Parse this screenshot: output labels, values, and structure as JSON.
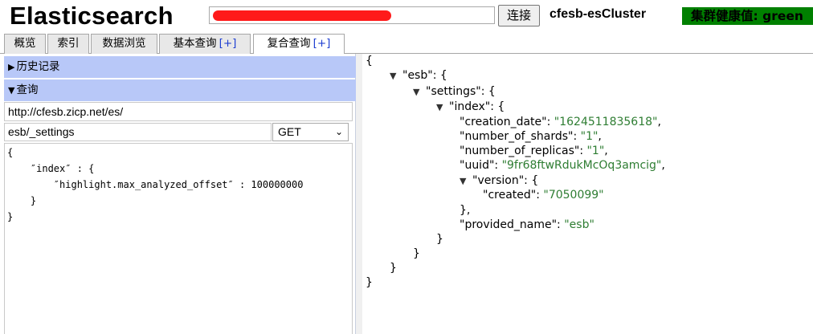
{
  "header": {
    "brand": "Elasticsearch",
    "connect_label": "连接",
    "cluster_name": "cfesb-esCluster",
    "health_label": "集群健康值: green"
  },
  "tabs": [
    {
      "label": "概览",
      "plus": ""
    },
    {
      "label": "索引",
      "plus": ""
    },
    {
      "label": "数据浏览",
      "plus": ""
    },
    {
      "label": "基本查询",
      "plus": "[+]"
    },
    {
      "label": "复合查询",
      "plus": "[+]",
      "active": true
    }
  ],
  "left": {
    "history_label": "历史记录",
    "query_label": "查询",
    "base_url": "http://cfesb.zicp.net/es/",
    "path": "esb/_settings",
    "method": "GET",
    "body_lines": [
      "{",
      "    ″index″ : {",
      "        ″highlight.max_analyzed_offset″ : 100000000",
      "    }",
      "}"
    ]
  },
  "json": {
    "open_brace": "{",
    "esb_key": "\"esb\"",
    "settings_key": "\"settings\"",
    "index_key": "\"index\"",
    "creation_date_key": "\"creation_date\"",
    "creation_date_val": "\"1624511835618\"",
    "shards_key": "\"number_of_shards\"",
    "shards_val": "\"1\"",
    "replicas_key": "\"number_of_replicas\"",
    "replicas_val": "\"1\"",
    "uuid_key": "\"uuid\"",
    "uuid_val": "\"9fr68ftwRdukMcOq3amcig\"",
    "version_key": "\"version\"",
    "created_key": "\"created\"",
    "created_val": "\"7050099\"",
    "provided_name_key": "\"provided_name\"",
    "provided_name_val": "\"esb\""
  },
  "colors": {
    "accordion": "#b8c8f8",
    "health": "#008000",
    "json_string": "#2e7d32",
    "redaction": "#ff1a1a"
  }
}
